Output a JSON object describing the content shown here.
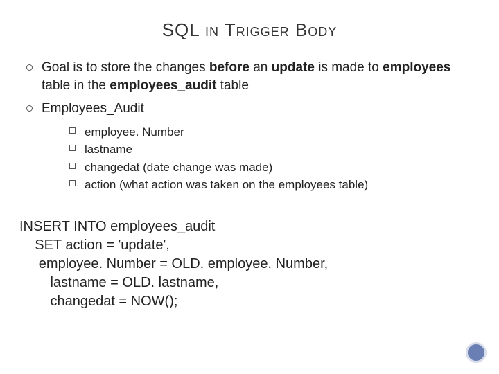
{
  "title": {
    "pre": "SQL ",
    "sc1": "in",
    "mid": " T",
    "sc2": "rigger",
    "mid2": " B",
    "sc3": "ody"
  },
  "bullets": {
    "item1": {
      "t1": "Goal is to store the changes ",
      "b1": "before",
      "t2": " an ",
      "b2": "update",
      "t3": " is made to ",
      "b3": "employees",
      "t4": " table in the ",
      "b4": "employees_audit",
      "t5": " table"
    },
    "item2": "Employees_Audit",
    "sub": [
      "employee. Number",
      "lastname",
      "changedat (date change was made)",
      "action (what action was taken on the employees table)"
    ]
  },
  "code": {
    "l1": "INSERT INTO employees_audit",
    "l2": "    SET action = 'update',",
    "l3": "     employee. Number = OLD. employee. Number,",
    "l4": "        lastname = OLD. lastname,",
    "l5": "        changedat = NOW();"
  }
}
